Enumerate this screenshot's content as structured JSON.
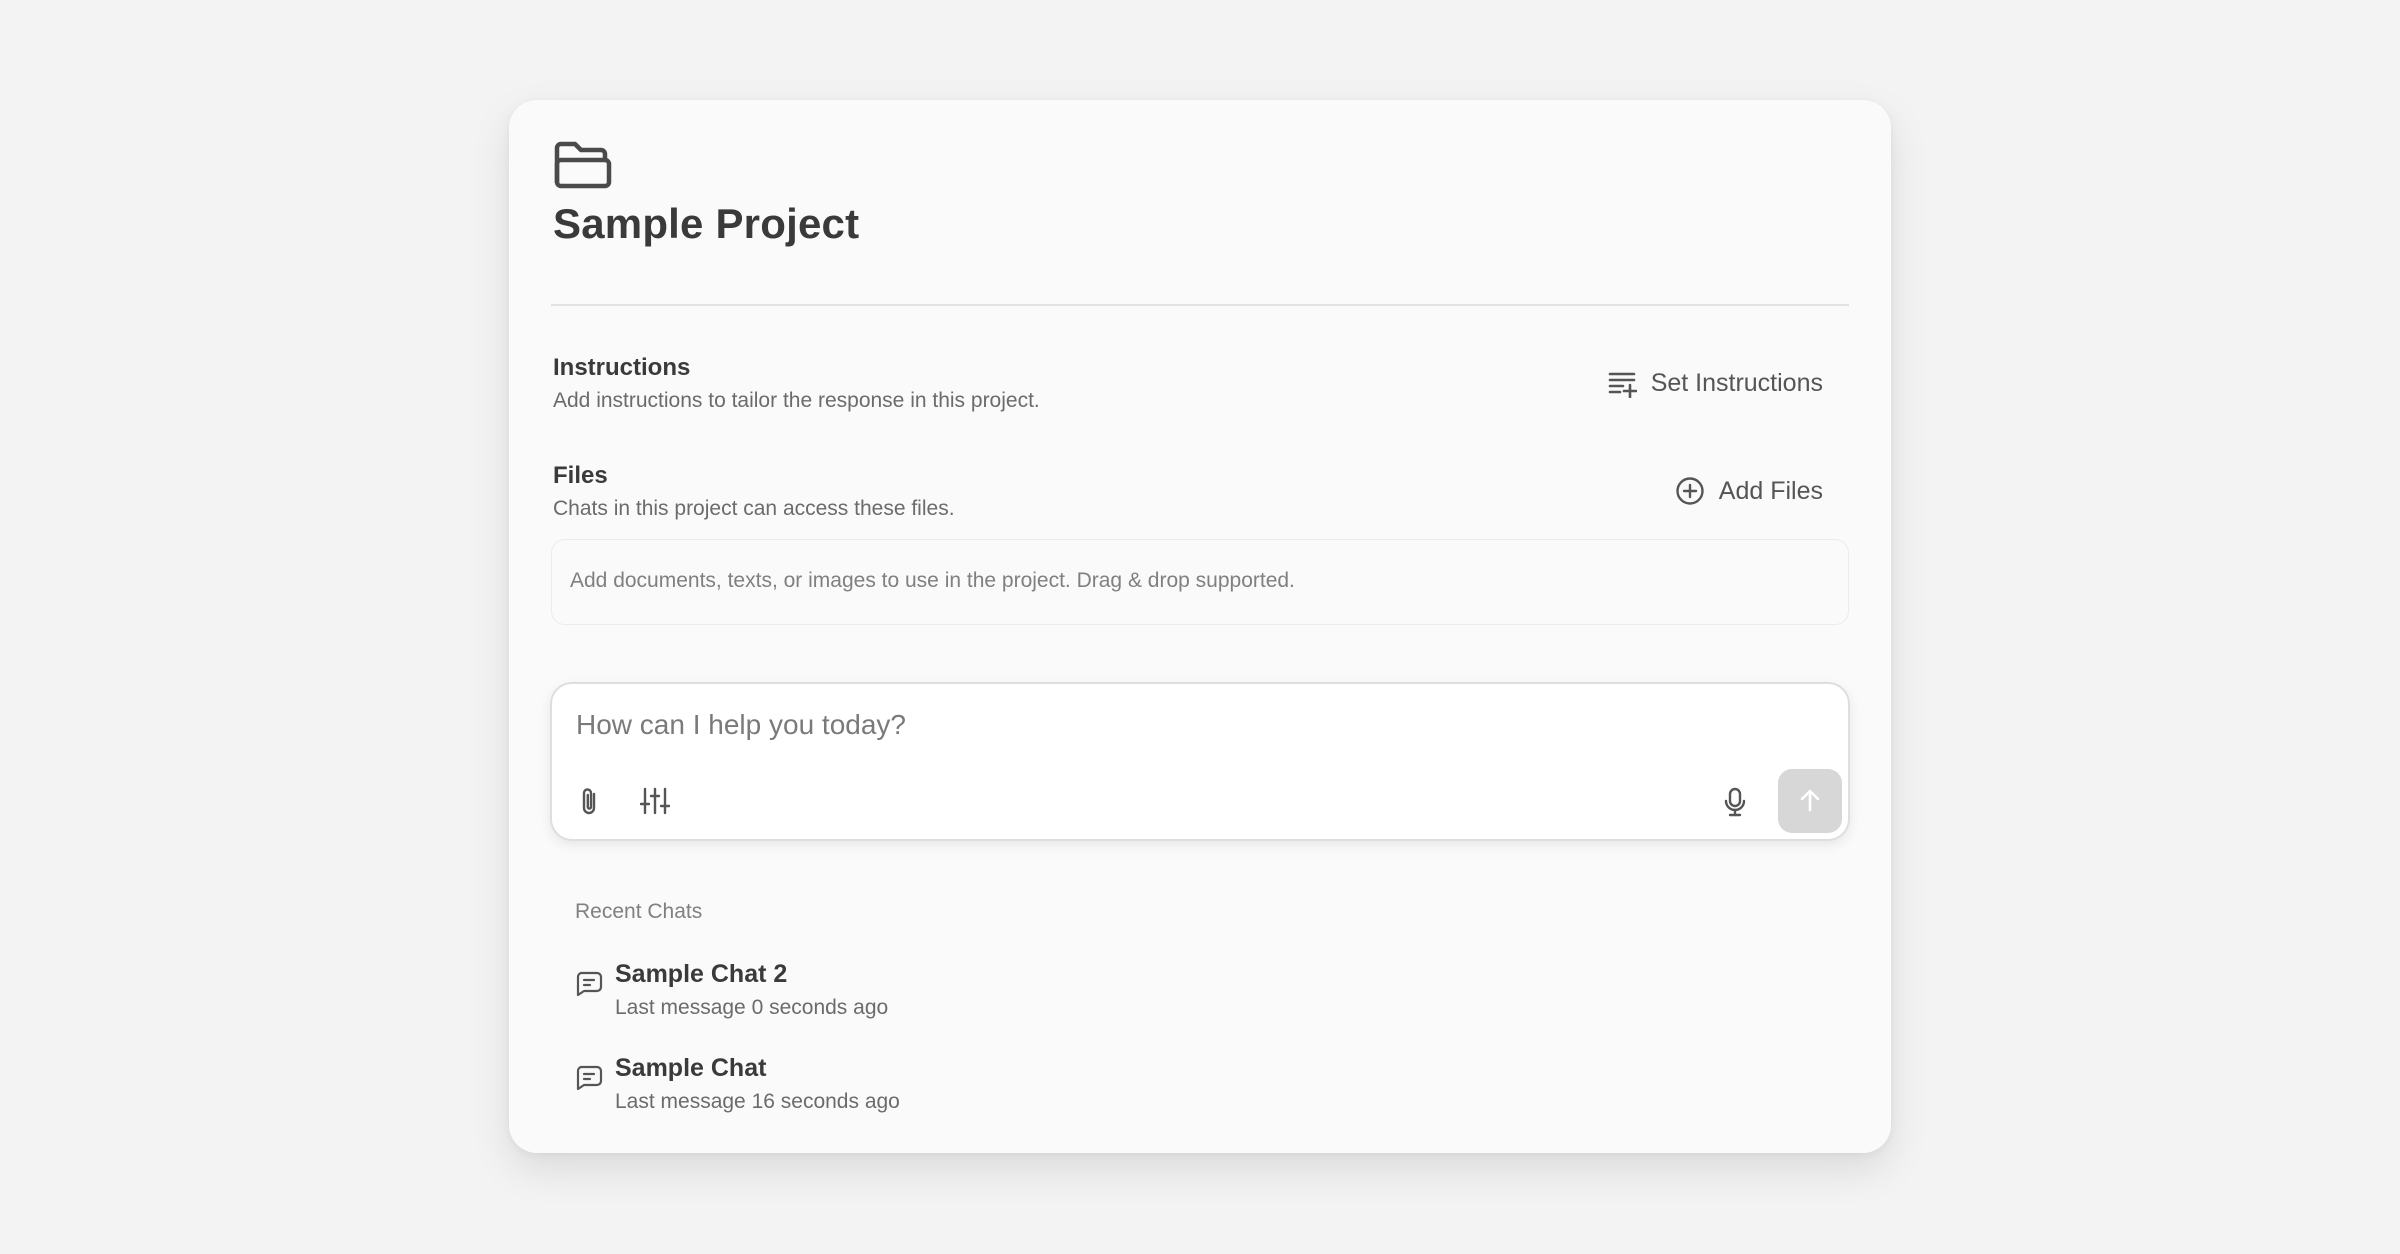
{
  "project": {
    "title": "Sample Project",
    "icon": "folder-open-icon"
  },
  "instructions": {
    "title": "Instructions",
    "description": "Add instructions to tailor the response in this project.",
    "action_label": "Set Instructions",
    "action_icon": "playlist-add-icon"
  },
  "files": {
    "title": "Files",
    "description": "Chats in this project can access these files.",
    "action_label": "Add Files",
    "action_icon": "plus-circle-icon",
    "dropzone_text": "Add documents, texts, or images to use in the project. Drag & drop supported."
  },
  "composer": {
    "placeholder": "How can I help you today?",
    "tools": [
      "paperclip-icon",
      "sliders-icon",
      "microphone-icon",
      "arrow-up-icon"
    ]
  },
  "recent_chats": {
    "title": "Recent Chats",
    "items": [
      {
        "title": "Sample Chat 2",
        "subtitle": "Last message 0 seconds ago"
      },
      {
        "title": "Sample Chat",
        "subtitle": "Last message 16 seconds ago"
      }
    ]
  },
  "colors": {
    "page_background": "#f3f3f3",
    "card_background": "#fafafa",
    "text_primary": "#3a3a3a",
    "text_secondary": "#6b6b6b",
    "send_button": "#d7d7d7"
  }
}
